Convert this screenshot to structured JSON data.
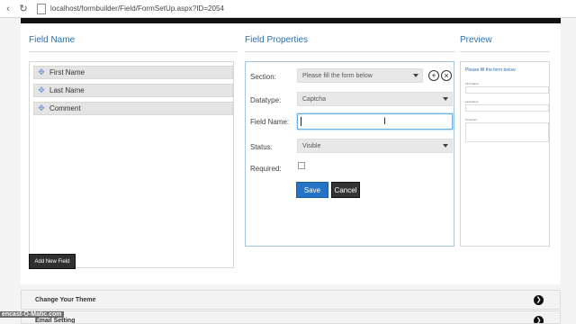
{
  "browser": {
    "url": "localhost/formbuilder/Field/FormSetUp.aspx?ID=2054"
  },
  "columns": {
    "field_name_title": "Field Name",
    "field_properties_title": "Field Properties",
    "preview_title": "Preview"
  },
  "fields": [
    {
      "label": "First Name"
    },
    {
      "label": "Last Name"
    },
    {
      "label": "Comment"
    }
  ],
  "properties": {
    "section_label": "Section:",
    "section_value": "Please fill the form below",
    "datatype_label": "Datatype:",
    "datatype_value": "Captcha",
    "field_name_label": "Field Name:",
    "field_name_value": "",
    "status_label": "Status:",
    "status_value": "Visible",
    "required_label": "Required:",
    "save_label": "Save",
    "cancel_label": "Cancel"
  },
  "preview": {
    "heading": "Please fill the form below",
    "fields": [
      {
        "label": "First Name"
      },
      {
        "label": "Last Name"
      },
      {
        "label": "Comment"
      }
    ]
  },
  "actions": {
    "add_new_field": "Add New Field"
  },
  "accordions": [
    {
      "label": "Change Your Theme"
    },
    {
      "label": "Email Setting"
    }
  ],
  "watermark": "encast-O-Matic.com",
  "colors": {
    "accent": "#2d6fa8",
    "save_button": "#2473c5",
    "dark_button": "#303030"
  }
}
